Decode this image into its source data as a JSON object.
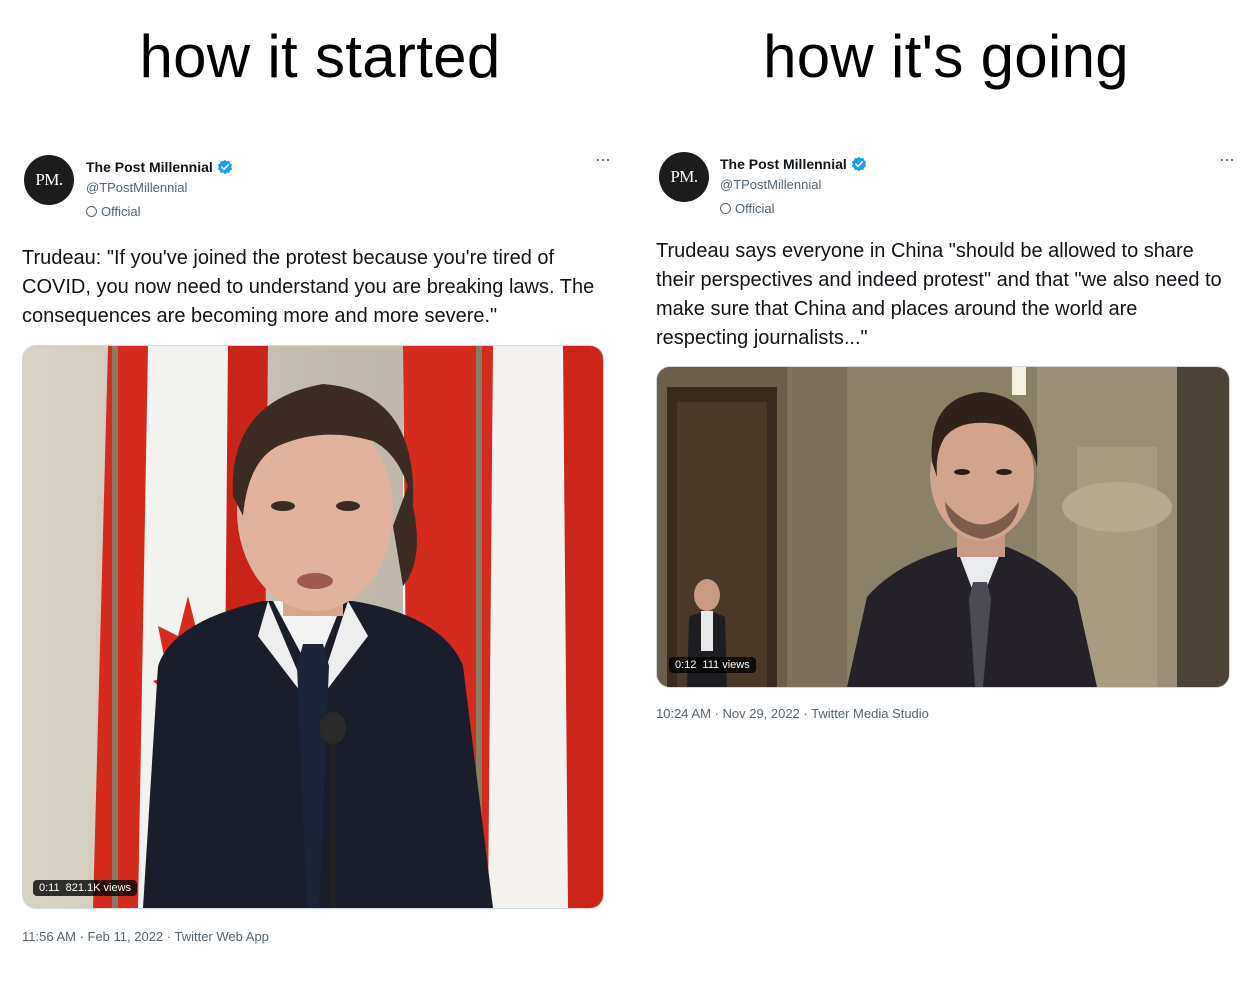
{
  "captions": {
    "left": "how it started",
    "right": "how it's going"
  },
  "tweets": [
    {
      "avatar_text": "PM.",
      "name": "The Post Millennial",
      "handle": "@TPostMillennial",
      "label": "Official",
      "more": "···",
      "text": "Trudeau: \"If you've joined the protest because you're tired of COVID, you now need to understand you are breaking laws. The consequences are becoming more and more severe.\"",
      "video_time": "0:11",
      "video_views": "821.1K views",
      "meta": "11:56 AM · Feb 11, 2022 · Twitter Web App"
    },
    {
      "avatar_text": "PM.",
      "name": "The Post Millennial",
      "handle": "@TPostMillennial",
      "label": "Official",
      "more": "···",
      "text": "Trudeau says everyone in China \"should be allowed to share their perspectives and indeed protest\" and that \"we also need to make sure that China and places around the world are respecting journalists...\"",
      "video_time": "0:12",
      "video_views": "111 views",
      "meta": "10:24 AM · Nov 29, 2022 · Twitter Media Studio"
    }
  ],
  "colors": {
    "verified": "#1d9bf0",
    "flag_red": "#d52b1e",
    "suit": "#1a1e2a"
  },
  "icons": [
    "verified-badge-icon",
    "official-label-icon",
    "more-options-icon"
  ]
}
